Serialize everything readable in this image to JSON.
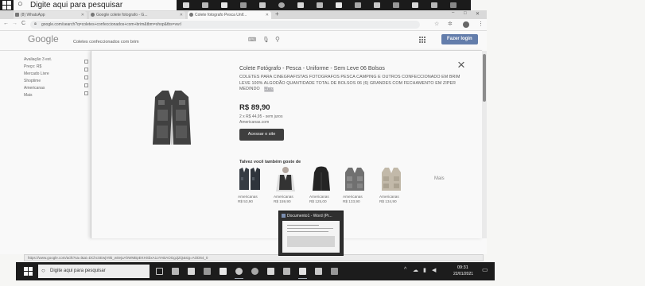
{
  "top_taskbar": {
    "search_placeholder": "Digite aqui para pesquisar"
  },
  "browser": {
    "tabs": [
      {
        "label": "(8) WhatsApp"
      },
      {
        "label": "Google colete fotografo - G..."
      },
      {
        "label": "Colete fotografo Pesca Unif..."
      }
    ],
    "address": "google.com/search?q=coletes+confeccionados+com+brim&tbm=shop&tbs=vw:l"
  },
  "google": {
    "logo": "Google",
    "query": "Coletes confeccionados com brim",
    "login_label": "Fazer login"
  },
  "sidebar": {
    "items": [
      "Avaliação 3 est.",
      "Preço: R$",
      "Mercado Livre",
      "Shoptime",
      "Americanas",
      "Mais"
    ]
  },
  "product": {
    "title": "Colete Fotógrafo - Pesca - Uniforme - Sem Leve 06 Bolsos",
    "description": "COLETES PARA CINEGRAFISTAS FOTOGRAFOS PESCA CAMPING E OUTROS CONFECCIONADO EM BRIM LEVE 100% ALGODÃO QUANTIDADE TOTAL DE BOLSOS 06 (6) GRANDES COM FECHAMENTO EM ZIPER MEDINDO",
    "more_label": "Mais",
    "price": "R$ 89,90",
    "installments": "2 x R$ 44,95 - sem juros",
    "store": "Americanas.com",
    "visit_label": "Acessar o site"
  },
  "similar": {
    "heading": "Talvez você também goste de",
    "items": [
      {
        "store": "Americanas",
        "price": "R$ 53,90"
      },
      {
        "store": "Americanas",
        "price": "R$ 159,90"
      },
      {
        "store": "Americanas",
        "price": "R$ 125,00"
      },
      {
        "store": "Americanas",
        "price": "R$ 133,90"
      },
      {
        "store": "Americanas",
        "price": "R$ 134,90"
      }
    ],
    "more_label": "Mais"
  },
  "preview": {
    "title": "Documento1 - Word (Pr..."
  },
  "status_url": "https://www.google.com/aclk?sa=l&ai=DChcSEwjV9b_w0ejuAhWMBpEKHSbxA1oYABAOGgJjZQ&sig=AOD64_0",
  "bottom_taskbar": {
    "search_placeholder": "Digite aqui para pesquisar",
    "time": "09:31",
    "date": "22/01/2021"
  },
  "colors": {
    "login_button": "#4d7fd6",
    "visit_button": "#3b3b3b",
    "taskbar": "#171717"
  }
}
